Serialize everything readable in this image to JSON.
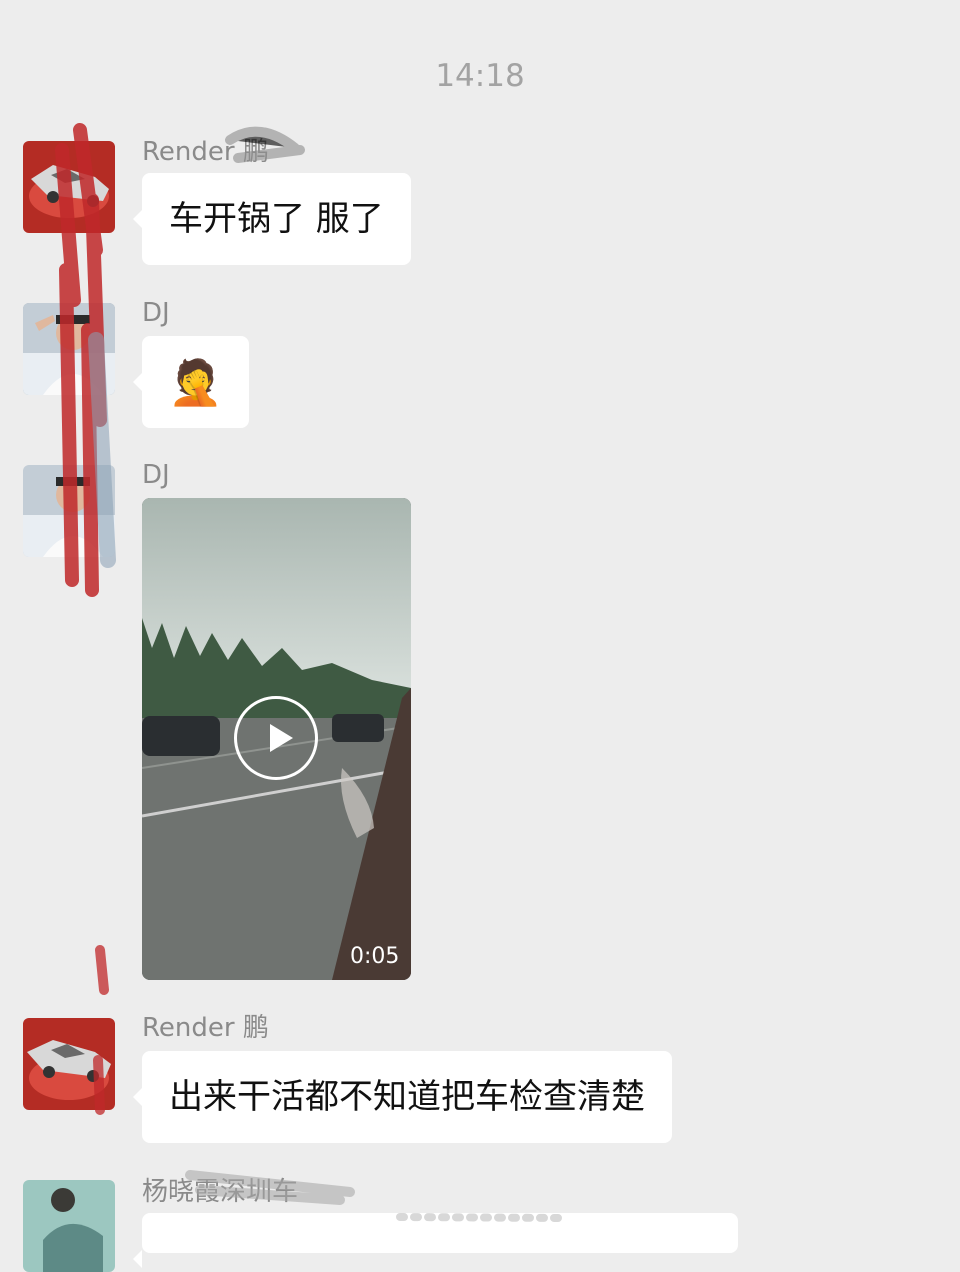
{
  "timestamp": "14:18",
  "messages": [
    {
      "sender": "Render 鹏",
      "text": "车开锅了 服了"
    },
    {
      "sender": "DJ",
      "emoji": "🤦"
    },
    {
      "sender": "DJ",
      "video_duration": "0:05"
    },
    {
      "sender": "Render 鹏",
      "text": "出来干活都不知道把车检查清楚"
    },
    {
      "sender": "杨晓霞深圳车"
    }
  ],
  "colors": {
    "background": "#ededed",
    "bubble": "#ffffff",
    "name": "#8a8a8a"
  },
  "icons": [
    "play-icon"
  ]
}
